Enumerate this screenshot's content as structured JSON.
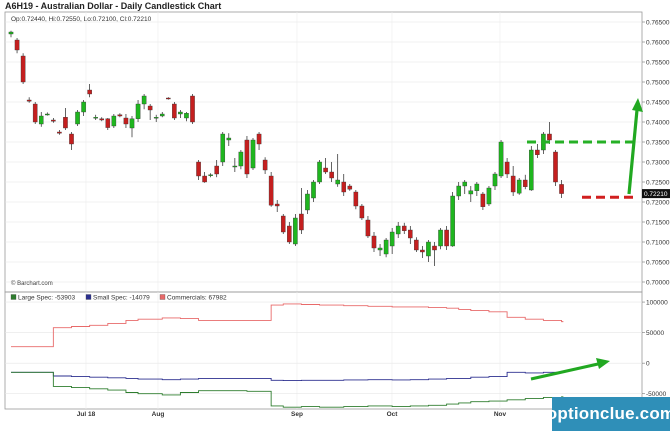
{
  "header": {
    "title": "A6H19 - Australian Dollar - Daily Candlestick Chart",
    "ohlc": "Op:0.72440, Hi:0.72550, Lo:0.72100, Cl:0.72210"
  },
  "credit": "© Barchart.com",
  "watermark": "optionclue.com",
  "colors": {
    "up": "#1fb61f",
    "down": "#c41f1f",
    "large_spec": "#2e7d2e",
    "small_spec": "#2b2f8f",
    "commercials": "#e86a6a",
    "annotation": "#21a821",
    "level_line_up": "#26b026",
    "level_line_down": "#d11f1f",
    "last_price_bg": "#111111"
  },
  "chart_data": [
    {
      "type": "candlestick",
      "title": "A6H19 - Australian Dollar - Daily Candlestick Chart",
      "ylim": [
        0.7,
        0.7655
      ],
      "yticks": [
        "0.76500",
        "0.76000",
        "0.75500",
        "0.75000",
        "0.74500",
        "0.74000",
        "0.73500",
        "0.73000",
        "0.72500",
        "0.72000",
        "0.71500",
        "0.71000",
        "0.70500",
        "0.70000"
      ],
      "xticks": [
        "Jul 18",
        "Aug",
        "Sep",
        "Oct",
        "Nov"
      ],
      "last_price_label": "0.72210",
      "ohlc": [
        [
          0.762,
          0.7628,
          0.7612,
          0.7625
        ],
        [
          0.7605,
          0.761,
          0.7572,
          0.758
        ],
        [
          0.7565,
          0.7572,
          0.7495,
          0.75
        ],
        [
          0.7455,
          0.7462,
          0.7448,
          0.7452
        ],
        [
          0.7445,
          0.745,
          0.7395,
          0.74
        ],
        [
          0.7395,
          0.7425,
          0.7388,
          0.7415
        ],
        [
          0.742,
          0.7424,
          0.7416,
          0.742
        ],
        [
          0.7405,
          0.741,
          0.7398,
          0.7402
        ],
        [
          0.7375,
          0.738,
          0.7368,
          0.7372
        ],
        [
          0.7412,
          0.7435,
          0.738,
          0.7385
        ],
        [
          0.737,
          0.7375,
          0.733,
          0.7345
        ],
        [
          0.7395,
          0.743,
          0.739,
          0.7425
        ],
        [
          0.7425,
          0.7455,
          0.7415,
          0.745
        ],
        [
          0.748,
          0.7495,
          0.7462,
          0.747
        ],
        [
          0.741,
          0.7418,
          0.7405,
          0.7412
        ],
        [
          0.7408,
          0.7412,
          0.7402,
          0.7405
        ],
        [
          0.7408,
          0.741,
          0.738,
          0.7386
        ],
        [
          0.739,
          0.742,
          0.7385,
          0.7415
        ],
        [
          0.7418,
          0.7422,
          0.7412,
          0.7415
        ],
        [
          0.741,
          0.742,
          0.7385,
          0.7395
        ],
        [
          0.7385,
          0.7415,
          0.7362,
          0.7408
        ],
        [
          0.7408,
          0.7455,
          0.74,
          0.7445
        ],
        [
          0.7445,
          0.747,
          0.7432,
          0.7465
        ],
        [
          0.744,
          0.7445,
          0.7405,
          0.743
        ],
        [
          0.741,
          0.7418,
          0.74,
          0.7412
        ],
        [
          0.7415,
          0.7425,
          0.7412,
          0.742
        ],
        [
          0.746,
          0.7462,
          0.7456,
          0.7458
        ],
        [
          0.7445,
          0.745,
          0.7405,
          0.741
        ],
        [
          0.742,
          0.743,
          0.741,
          0.7425
        ],
        [
          0.741,
          0.7425,
          0.7402,
          0.7422
        ],
        [
          0.7465,
          0.747,
          0.7395,
          0.74
        ],
        [
          0.73,
          0.7305,
          0.7255,
          0.7265
        ],
        [
          0.7265,
          0.7275,
          0.7248,
          0.725
        ],
        [
          0.7268,
          0.7272,
          0.7262,
          0.7268
        ],
        [
          0.729,
          0.7305,
          0.7262,
          0.727
        ],
        [
          0.73,
          0.7375,
          0.729,
          0.737
        ],
        [
          0.7355,
          0.7372,
          0.734,
          0.736
        ],
        [
          0.729,
          0.731,
          0.7275,
          0.729
        ],
        [
          0.729,
          0.733,
          0.7282,
          0.7325
        ],
        [
          0.7355,
          0.7365,
          0.726,
          0.727
        ],
        [
          0.7285,
          0.736,
          0.728,
          0.7355
        ],
        [
          0.737,
          0.7375,
          0.733,
          0.7345
        ],
        [
          0.7305,
          0.7312,
          0.727,
          0.728
        ],
        [
          0.7265,
          0.7275,
          0.7188,
          0.7192
        ],
        [
          0.7195,
          0.7205,
          0.7175,
          0.719
        ],
        [
          0.7165,
          0.717,
          0.712,
          0.7125
        ],
        [
          0.714,
          0.715,
          0.7095,
          0.71
        ],
        [
          0.7095,
          0.717,
          0.709,
          0.716
        ],
        [
          0.717,
          0.7235,
          0.712,
          0.713
        ],
        [
          0.718,
          0.723,
          0.717,
          0.722
        ],
        [
          0.721,
          0.7255,
          0.72,
          0.725
        ],
        [
          0.725,
          0.7305,
          0.7245,
          0.73
        ],
        [
          0.7285,
          0.731,
          0.727,
          0.7275
        ],
        [
          0.7275,
          0.73,
          0.725,
          0.726
        ],
        [
          0.7245,
          0.732,
          0.7238,
          0.7255
        ],
        [
          0.725,
          0.727,
          0.7215,
          0.7225
        ],
        [
          0.724,
          0.7245,
          0.7228,
          0.7232
        ],
        [
          0.7225,
          0.723,
          0.7182,
          0.719
        ],
        [
          0.719,
          0.7195,
          0.7155,
          0.716
        ],
        [
          0.7155,
          0.7165,
          0.711,
          0.7115
        ],
        [
          0.7115,
          0.7125,
          0.7075,
          0.7085
        ],
        [
          0.708,
          0.7095,
          0.7065,
          0.7085
        ],
        [
          0.707,
          0.711,
          0.7062,
          0.7105
        ],
        [
          0.709,
          0.7135,
          0.707,
          0.7125
        ],
        [
          0.712,
          0.715,
          0.711,
          0.714
        ],
        [
          0.714,
          0.7148,
          0.712,
          0.7128
        ],
        [
          0.713,
          0.714,
          0.7095,
          0.711
        ],
        [
          0.7105,
          0.7112,
          0.7075,
          0.708
        ],
        [
          0.708,
          0.709,
          0.706,
          0.7075
        ],
        [
          0.7065,
          0.7105,
          0.705,
          0.71
        ],
        [
          0.709,
          0.71,
          0.704,
          0.708
        ],
        [
          0.709,
          0.7135,
          0.7082,
          0.713
        ],
        [
          0.713,
          0.714,
          0.708,
          0.709
        ],
        [
          0.709,
          0.7225,
          0.7088,
          0.7215
        ],
        [
          0.7215,
          0.725,
          0.7205,
          0.724
        ],
        [
          0.724,
          0.7255,
          0.722,
          0.725
        ],
        [
          0.722,
          0.724,
          0.72,
          0.7228
        ],
        [
          0.7228,
          0.725,
          0.7215,
          0.7245
        ],
        [
          0.722,
          0.7225,
          0.718,
          0.7188
        ],
        [
          0.7195,
          0.724,
          0.719,
          0.7235
        ],
        [
          0.724,
          0.7275,
          0.723,
          0.727
        ],
        [
          0.7265,
          0.7355,
          0.726,
          0.735
        ],
        [
          0.73,
          0.731,
          0.726,
          0.727
        ],
        [
          0.7265,
          0.729,
          0.7215,
          0.7225
        ],
        [
          0.7222,
          0.726,
          0.7218,
          0.7255
        ],
        [
          0.7255,
          0.7268,
          0.7232,
          0.7238
        ],
        [
          0.723,
          0.734,
          0.7228,
          0.733
        ],
        [
          0.733,
          0.7345,
          0.731,
          0.7318
        ],
        [
          0.733,
          0.7375,
          0.732,
          0.737
        ],
        [
          0.737,
          0.74,
          0.7345,
          0.7355
        ],
        [
          0.7325,
          0.733,
          0.724,
          0.725
        ],
        [
          0.7244,
          0.7255,
          0.721,
          0.7221
        ]
      ],
      "annotations": {
        "resistance_level": 0.735,
        "support_level": 0.7212
      }
    },
    {
      "type": "line",
      "title": "Commitment of Traders",
      "ylim": [
        -75000,
        105000
      ],
      "yticks": [
        "100000",
        "50000",
        "0",
        "-50000"
      ],
      "series": [
        {
          "name": "Large Spec: -53903",
          "color_key": "large_spec",
          "x": [
            0,
            4,
            7,
            10,
            13,
            16,
            19,
            21,
            25,
            28,
            31,
            35,
            39,
            43,
            45,
            48,
            51,
            55,
            59,
            63,
            66,
            69,
            72,
            74,
            76,
            79,
            82,
            85,
            88,
            91
          ],
          "values": [
            -15000,
            -15000,
            -38000,
            -40000,
            -42000,
            -44000,
            -48000,
            -50000,
            -52000,
            -48000,
            -45000,
            -45000,
            -46000,
            -70000,
            -72000,
            -71000,
            -72000,
            -71000,
            -70000,
            -71000,
            -70000,
            -69000,
            -67000,
            -65000,
            -63000,
            -62000,
            -60000,
            -58000,
            -56000,
            -55000
          ]
        },
        {
          "name": "Small Spec: -14079",
          "color_key": "small_spec",
          "x": [
            0,
            4,
            7,
            10,
            13,
            16,
            19,
            21,
            25,
            28,
            31,
            35,
            39,
            43,
            45,
            48,
            51,
            55,
            59,
            63,
            66,
            69,
            72,
            74,
            76,
            79,
            82,
            85,
            88,
            91
          ],
          "values": [
            -15000,
            -15000,
            -21000,
            -22000,
            -23000,
            -24000,
            -25000,
            -26000,
            -27000,
            -26000,
            -25000,
            -25000,
            -25000,
            -28000,
            -28500,
            -28000,
            -28000,
            -27500,
            -27000,
            -27500,
            -27000,
            -26000,
            -25000,
            -25000,
            -23000,
            -22000,
            -15000,
            -16000,
            -15000,
            -14079
          ]
        },
        {
          "name": "Commercials: 67982",
          "color_key": "commercials",
          "x": [
            0,
            4,
            7,
            10,
            13,
            16,
            19,
            21,
            25,
            28,
            31,
            35,
            39,
            43,
            45,
            48,
            51,
            55,
            59,
            63,
            66,
            69,
            72,
            74,
            76,
            79,
            82,
            85,
            88,
            91
          ],
          "values": [
            27000,
            27000,
            58000,
            60000,
            62000,
            65000,
            70000,
            72000,
            74000,
            73000,
            70000,
            70000,
            70000,
            95000,
            97000,
            96000,
            95000,
            94000,
            93000,
            92000,
            92000,
            91000,
            90000,
            88000,
            86000,
            84000,
            75000,
            72000,
            70000,
            67982
          ]
        }
      ]
    }
  ]
}
